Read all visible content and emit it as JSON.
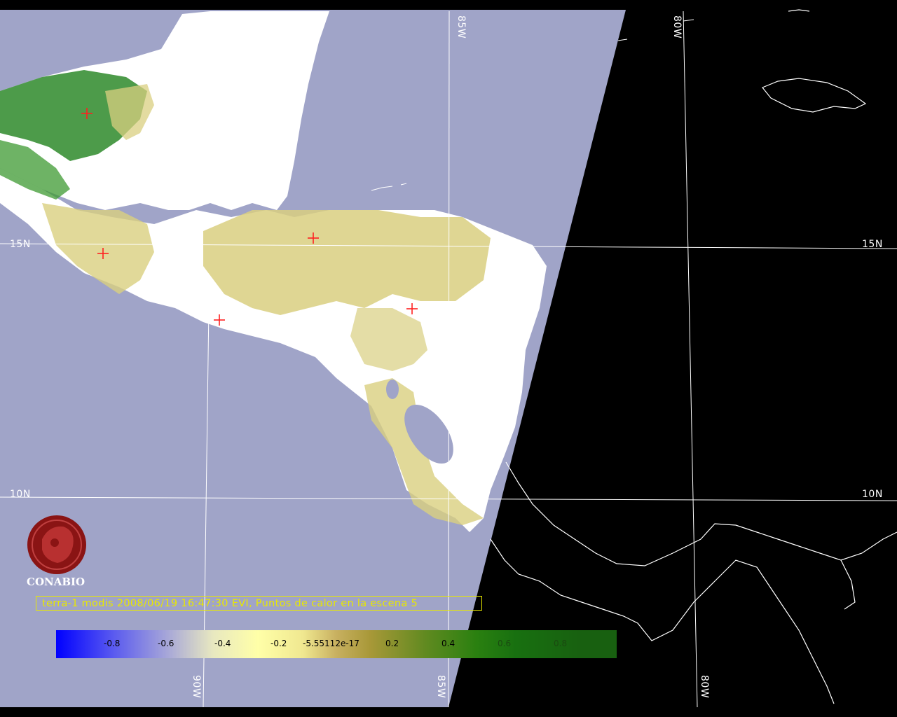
{
  "grid": {
    "lon_labels_top": [
      "85W",
      "80W"
    ],
    "lon_labels_bottom": [
      "90W",
      "85W",
      "80W"
    ],
    "lat_labels": [
      "15N",
      "10N"
    ]
  },
  "logo": {
    "text": "CONABIO"
  },
  "caption": "terra-1 modis 2008/06/19 16:47:30 EVI, Puntos de calor en la escena 5",
  "colorbar": {
    "ticks": [
      "-0.8",
      "-0.6",
      "-0.4",
      "-0.2",
      "-5.55112e-17",
      "0.2",
      "0.4",
      "0.6",
      "0.8"
    ]
  },
  "colors": {
    "ocean": "#a0a4c8",
    "night": "#000000",
    "land_cloud": "#ffffff",
    "low_veg": "#e0d890",
    "high_veg": "#1e7a1e",
    "grid": "#ffffff",
    "hotspot": "#ff2020",
    "caption": "#e8e800"
  },
  "hotspots_count": 5
}
